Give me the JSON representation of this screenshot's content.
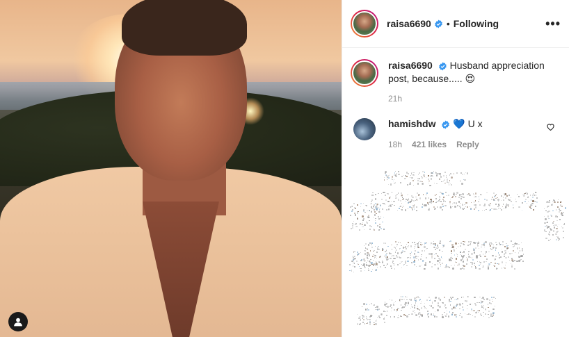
{
  "post": {
    "author": "raisa6690",
    "follow_status": "Following",
    "separator": "•",
    "more_icon": "•••",
    "caption_user": "raisa6690",
    "caption_text": "Husband appreciation post, because..... 😍",
    "time": "21h"
  },
  "comment": {
    "user": "hamishdw",
    "text": "💙 U x",
    "time": "18h",
    "likes": "421 likes",
    "reply": "Reply"
  },
  "icons": {
    "verified": "verified-badge-icon",
    "heart": "heart-outline-icon",
    "tag": "user-tag-icon",
    "more": "more-dots-icon"
  },
  "colors": {
    "verified_blue": "#3897f0",
    "muted": "#8e8e8e",
    "text": "#262626",
    "divider": "#efefef"
  }
}
